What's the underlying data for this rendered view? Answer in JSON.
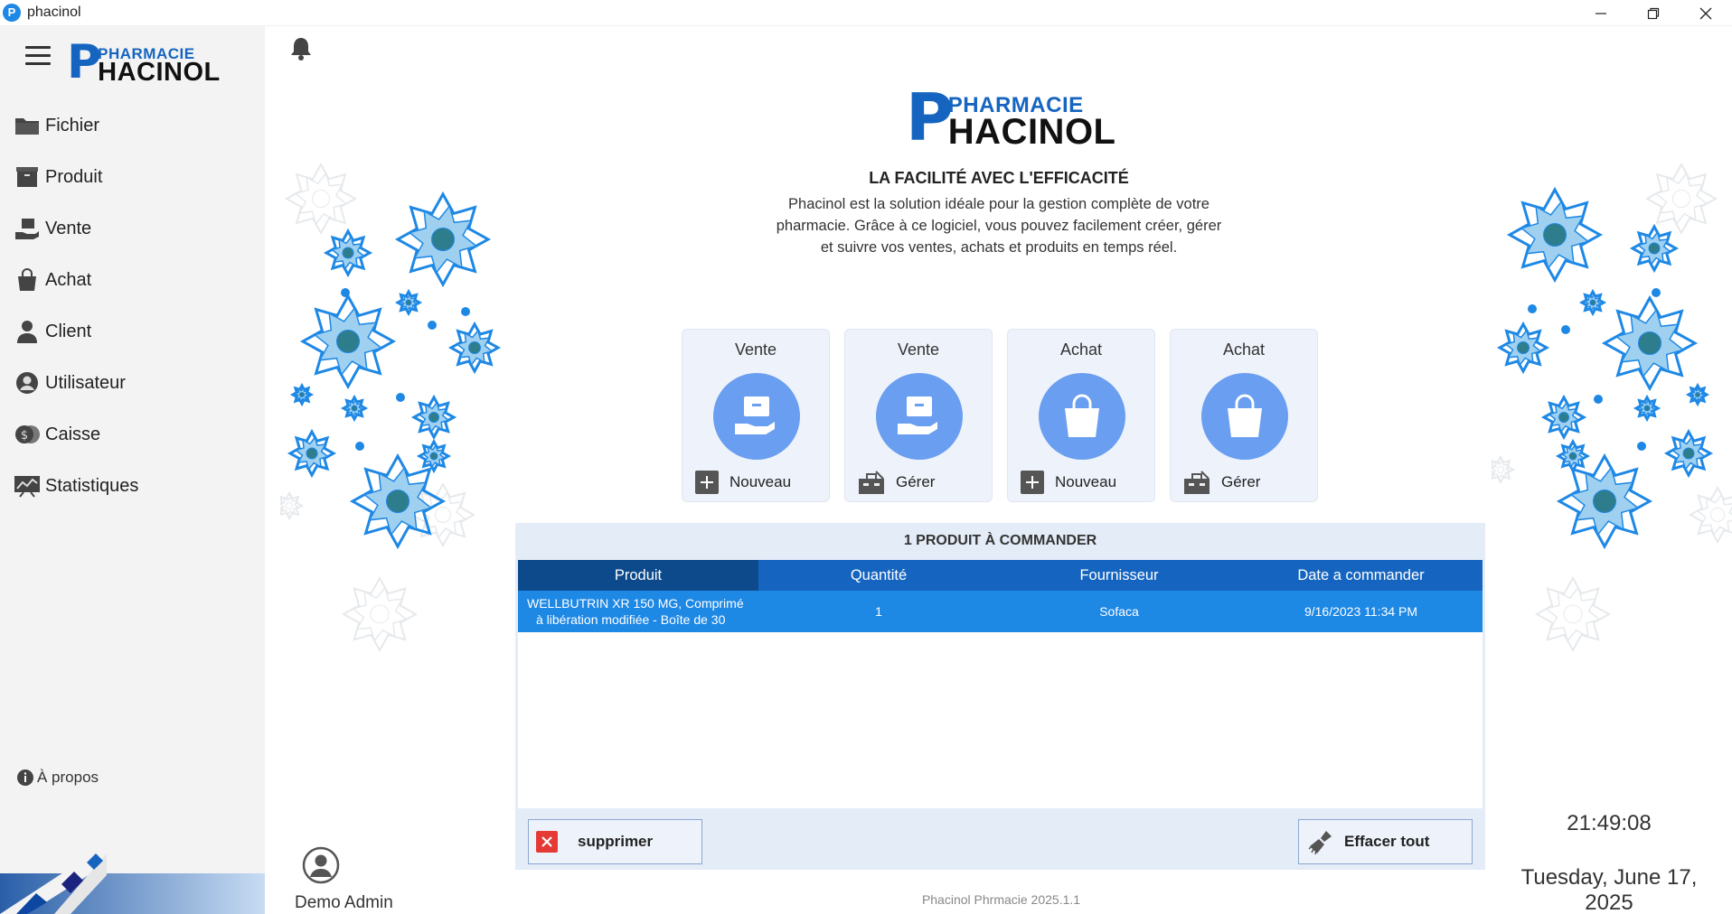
{
  "window": {
    "title": "phacinol",
    "app_icon": "P"
  },
  "logo": {
    "letter": "P",
    "top": "PHARMACIE",
    "bottom": "HACINOL"
  },
  "sidebar": {
    "items": [
      {
        "label": "Fichier",
        "icon": "folder-icon"
      },
      {
        "label": "Produit",
        "icon": "box-icon"
      },
      {
        "label": "Vente",
        "icon": "hand-box-icon"
      },
      {
        "label": "Achat",
        "icon": "shopping-bag-icon"
      },
      {
        "label": "Client",
        "icon": "person-icon"
      },
      {
        "label": "Utilisateur",
        "icon": "user-circle-icon"
      },
      {
        "label": "Caisse",
        "icon": "cash-icon"
      },
      {
        "label": "Statistiques",
        "icon": "chart-icon"
      }
    ],
    "about": "À propos"
  },
  "main": {
    "tagline": "LA FACILITÉ AVEC L'EFFICACITÉ",
    "desc_lines": [
      "Phacinol est la solution idéale pour la gestion complète de votre",
      "pharmacie. Grâce à ce logiciel, vous pouvez facilement créer, gérer",
      "et suivre vos ventes, achats et produits en temps réel."
    ],
    "cards": [
      {
        "title": "Vente",
        "action": "Nouveau"
      },
      {
        "title": "Vente",
        "action": "Gérer"
      },
      {
        "title": "Achat",
        "action": "Nouveau"
      },
      {
        "title": "Achat",
        "action": "Gérer"
      }
    ]
  },
  "orders": {
    "title": "1 PRODUIT À COMMANDER",
    "columns": [
      "Produit",
      "Quantité",
      "Fournisseur",
      "Date a commander"
    ],
    "rows": [
      {
        "product_l1": "WELLBUTRIN XR 150 MG, Comprimé",
        "product_l2": "à libération modifiée - Boîte de 30",
        "qty": "1",
        "supplier": "Sofaca",
        "date": "9/16/2023 11:34 PM"
      }
    ],
    "delete_label": "supprimer",
    "clear_label": "Effacer tout"
  },
  "footer": {
    "version": "Phacinol Phrmacie 2025.1.1",
    "user": "Demo Admin",
    "time": "21:49:08",
    "date": "Tuesday, June 17, 2025"
  },
  "colors": {
    "accent": "#1565c0",
    "row_selected": "#1e88e5",
    "header_active": "#0d4a8c",
    "circle": "#6a9ef0"
  }
}
